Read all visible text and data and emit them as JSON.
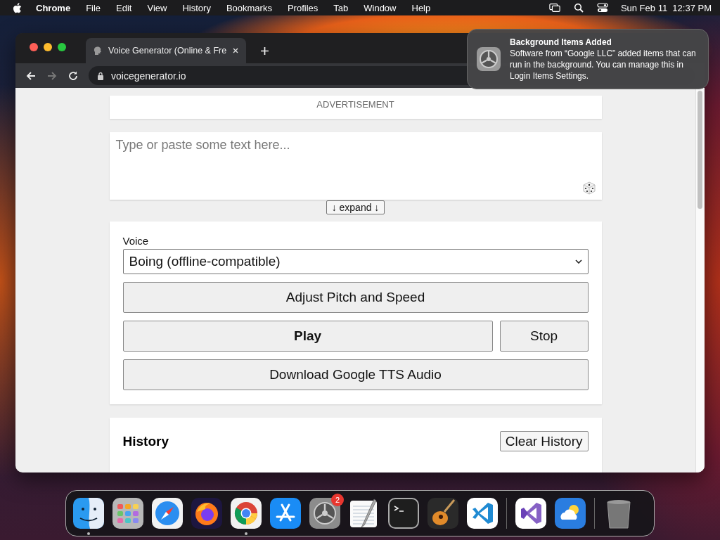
{
  "menubar": {
    "app": "Chrome",
    "items": [
      "File",
      "Edit",
      "View",
      "History",
      "Bookmarks",
      "Profiles",
      "Tab",
      "Window",
      "Help"
    ],
    "clock": "Sun Feb 11  12:37 PM"
  },
  "browser": {
    "tabs": [
      {
        "title": "Voice Generator (Online & Fre",
        "selected": true
      }
    ],
    "url": "voicegenerator.io"
  },
  "page": {
    "ad_label": "ADVERTISEMENT",
    "text_input": {
      "placeholder": "Type or paste some text here..."
    },
    "expand_button": "↓ expand ↓",
    "voice": {
      "label": "Voice",
      "value": "Boing (offline-compatible)"
    },
    "adjust_button": "Adjust Pitch and Speed",
    "play_button": "Play",
    "stop_button": "Stop",
    "download_button": "Download Google TTS Audio",
    "history": {
      "title": "History",
      "clear_button": "Clear History"
    }
  },
  "notification": {
    "title": "Background Items Added",
    "body": "Software from “Google LLC” added items that can run in the background. You can manage this in Login Items Settings."
  },
  "dock": [
    {
      "kind": "finder",
      "running": true
    },
    {
      "kind": "launchpad",
      "running": false
    },
    {
      "kind": "safari",
      "running": false
    },
    {
      "kind": "firefox",
      "running": false
    },
    {
      "kind": "chrome",
      "running": true
    },
    {
      "kind": "appstore",
      "running": false
    },
    {
      "kind": "settings",
      "running": false,
      "badge": "2"
    },
    {
      "kind": "textedit",
      "running": false
    },
    {
      "kind": "terminal",
      "running": false
    },
    {
      "kind": "guitar",
      "running": false
    },
    {
      "kind": "vscode",
      "running": false
    },
    {
      "kind": "separator"
    },
    {
      "kind": "visualstudio",
      "running": false
    },
    {
      "kind": "weather",
      "running": false
    },
    {
      "kind": "separator"
    },
    {
      "kind": "trash",
      "running": false
    }
  ]
}
